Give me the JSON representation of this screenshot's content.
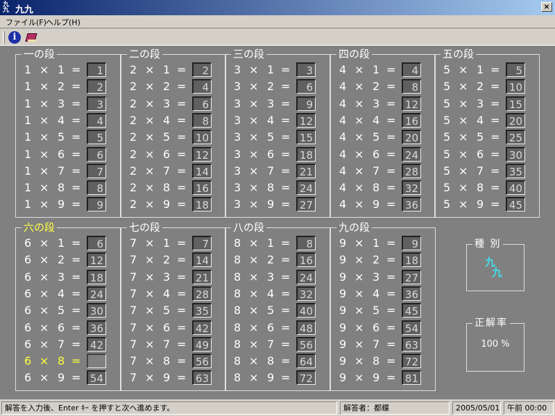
{
  "window": {
    "title": "九九",
    "icon_text": "九九",
    "close_label": "×"
  },
  "menu": [
    {
      "label": "ファイル(F)"
    },
    {
      "label": "ヘルプ(H)"
    }
  ],
  "toolbar": {
    "info_icon": "info-icon",
    "info_glyph": "i",
    "book_icon": "book-icon"
  },
  "groups": [
    {
      "title": "一の段",
      "rows": [
        {
          "a": "1",
          "b": "1",
          "ans": "1"
        },
        {
          "a": "1",
          "b": "2",
          "ans": "2"
        },
        {
          "a": "1",
          "b": "3",
          "ans": "3"
        },
        {
          "a": "1",
          "b": "4",
          "ans": "4"
        },
        {
          "a": "1",
          "b": "5",
          "ans": "5"
        },
        {
          "a": "1",
          "b": "6",
          "ans": "6"
        },
        {
          "a": "1",
          "b": "7",
          "ans": "7"
        },
        {
          "a": "1",
          "b": "8",
          "ans": "8"
        },
        {
          "a": "1",
          "b": "9",
          "ans": "9"
        }
      ]
    },
    {
      "title": "二の段",
      "rows": [
        {
          "a": "2",
          "b": "1",
          "ans": "2"
        },
        {
          "a": "2",
          "b": "2",
          "ans": "4"
        },
        {
          "a": "2",
          "b": "3",
          "ans": "6"
        },
        {
          "a": "2",
          "b": "4",
          "ans": "8"
        },
        {
          "a": "2",
          "b": "5",
          "ans": "10"
        },
        {
          "a": "2",
          "b": "6",
          "ans": "12"
        },
        {
          "a": "2",
          "b": "7",
          "ans": "14"
        },
        {
          "a": "2",
          "b": "8",
          "ans": "16"
        },
        {
          "a": "2",
          "b": "9",
          "ans": "18"
        }
      ]
    },
    {
      "title": "三の段",
      "rows": [
        {
          "a": "3",
          "b": "1",
          "ans": "3"
        },
        {
          "a": "3",
          "b": "2",
          "ans": "6"
        },
        {
          "a": "3",
          "b": "3",
          "ans": "9"
        },
        {
          "a": "3",
          "b": "4",
          "ans": "12"
        },
        {
          "a": "3",
          "b": "5",
          "ans": "15"
        },
        {
          "a": "3",
          "b": "6",
          "ans": "18"
        },
        {
          "a": "3",
          "b": "7",
          "ans": "21"
        },
        {
          "a": "3",
          "b": "8",
          "ans": "24"
        },
        {
          "a": "3",
          "b": "9",
          "ans": "27"
        }
      ]
    },
    {
      "title": "四の段",
      "rows": [
        {
          "a": "4",
          "b": "1",
          "ans": "4"
        },
        {
          "a": "4",
          "b": "2",
          "ans": "8"
        },
        {
          "a": "4",
          "b": "3",
          "ans": "12"
        },
        {
          "a": "4",
          "b": "4",
          "ans": "16"
        },
        {
          "a": "4",
          "b": "5",
          "ans": "20"
        },
        {
          "a": "4",
          "b": "6",
          "ans": "24"
        },
        {
          "a": "4",
          "b": "7",
          "ans": "28"
        },
        {
          "a": "4",
          "b": "8",
          "ans": "32"
        },
        {
          "a": "4",
          "b": "9",
          "ans": "36"
        }
      ]
    },
    {
      "title": "五の段",
      "rows": [
        {
          "a": "5",
          "b": "1",
          "ans": "5"
        },
        {
          "a": "5",
          "b": "2",
          "ans": "10"
        },
        {
          "a": "5",
          "b": "3",
          "ans": "15"
        },
        {
          "a": "5",
          "b": "4",
          "ans": "20"
        },
        {
          "a": "5",
          "b": "5",
          "ans": "25"
        },
        {
          "a": "5",
          "b": "6",
          "ans": "30"
        },
        {
          "a": "5",
          "b": "7",
          "ans": "35"
        },
        {
          "a": "5",
          "b": "8",
          "ans": "40"
        },
        {
          "a": "5",
          "b": "9",
          "ans": "45"
        }
      ]
    },
    {
      "title": "六の段",
      "active": true,
      "rows": [
        {
          "a": "6",
          "b": "1",
          "ans": "6"
        },
        {
          "a": "6",
          "b": "2",
          "ans": "12"
        },
        {
          "a": "6",
          "b": "3",
          "ans": "18"
        },
        {
          "a": "6",
          "b": "4",
          "ans": "24"
        },
        {
          "a": "6",
          "b": "5",
          "ans": "30"
        },
        {
          "a": "6",
          "b": "6",
          "ans": "36"
        },
        {
          "a": "6",
          "b": "7",
          "ans": "42"
        },
        {
          "a": "6",
          "b": "8",
          "ans": "",
          "current": true
        },
        {
          "a": "6",
          "b": "9",
          "ans": "54"
        }
      ]
    },
    {
      "title": "七の段",
      "rows": [
        {
          "a": "7",
          "b": "1",
          "ans": "7"
        },
        {
          "a": "7",
          "b": "2",
          "ans": "14"
        },
        {
          "a": "7",
          "b": "3",
          "ans": "21"
        },
        {
          "a": "7",
          "b": "4",
          "ans": "28"
        },
        {
          "a": "7",
          "b": "5",
          "ans": "35"
        },
        {
          "a": "7",
          "b": "6",
          "ans": "42"
        },
        {
          "a": "7",
          "b": "7",
          "ans": "49"
        },
        {
          "a": "7",
          "b": "8",
          "ans": "56"
        },
        {
          "a": "7",
          "b": "9",
          "ans": "63"
        }
      ]
    },
    {
      "title": "八の段",
      "rows": [
        {
          "a": "8",
          "b": "1",
          "ans": "8"
        },
        {
          "a": "8",
          "b": "2",
          "ans": "16"
        },
        {
          "a": "8",
          "b": "3",
          "ans": "24"
        },
        {
          "a": "8",
          "b": "4",
          "ans": "32"
        },
        {
          "a": "8",
          "b": "5",
          "ans": "40"
        },
        {
          "a": "8",
          "b": "6",
          "ans": "48"
        },
        {
          "a": "8",
          "b": "7",
          "ans": "56"
        },
        {
          "a": "8",
          "b": "8",
          "ans": "64"
        },
        {
          "a": "8",
          "b": "9",
          "ans": "72"
        }
      ]
    },
    {
      "title": "九の段",
      "rows": [
        {
          "a": "9",
          "b": "1",
          "ans": "9"
        },
        {
          "a": "9",
          "b": "2",
          "ans": "18"
        },
        {
          "a": "9",
          "b": "3",
          "ans": "27"
        },
        {
          "a": "9",
          "b": "4",
          "ans": "36"
        },
        {
          "a": "9",
          "b": "5",
          "ans": "45"
        },
        {
          "a": "9",
          "b": "6",
          "ans": "54"
        },
        {
          "a": "9",
          "b": "7",
          "ans": "63"
        },
        {
          "a": "9",
          "b": "8",
          "ans": "72"
        },
        {
          "a": "9",
          "b": "9",
          "ans": "81"
        }
      ]
    }
  ],
  "symbols": {
    "times": "×",
    "equals": "="
  },
  "kind": {
    "label": "種 別",
    "value_line1": "九",
    "value_line2": "九"
  },
  "rate": {
    "label": "正解率",
    "value": "100 %"
  },
  "status": {
    "message": "解答を入力後、Enter ｷｰ を押すと次へ進めます。",
    "user": "解答者：都蝶",
    "date": "2005/05/01",
    "time": "午前 00:00"
  },
  "colors": {
    "active_text": "#ffff40",
    "panel_bg": "#808080",
    "kind_value": "#40e0f0"
  }
}
